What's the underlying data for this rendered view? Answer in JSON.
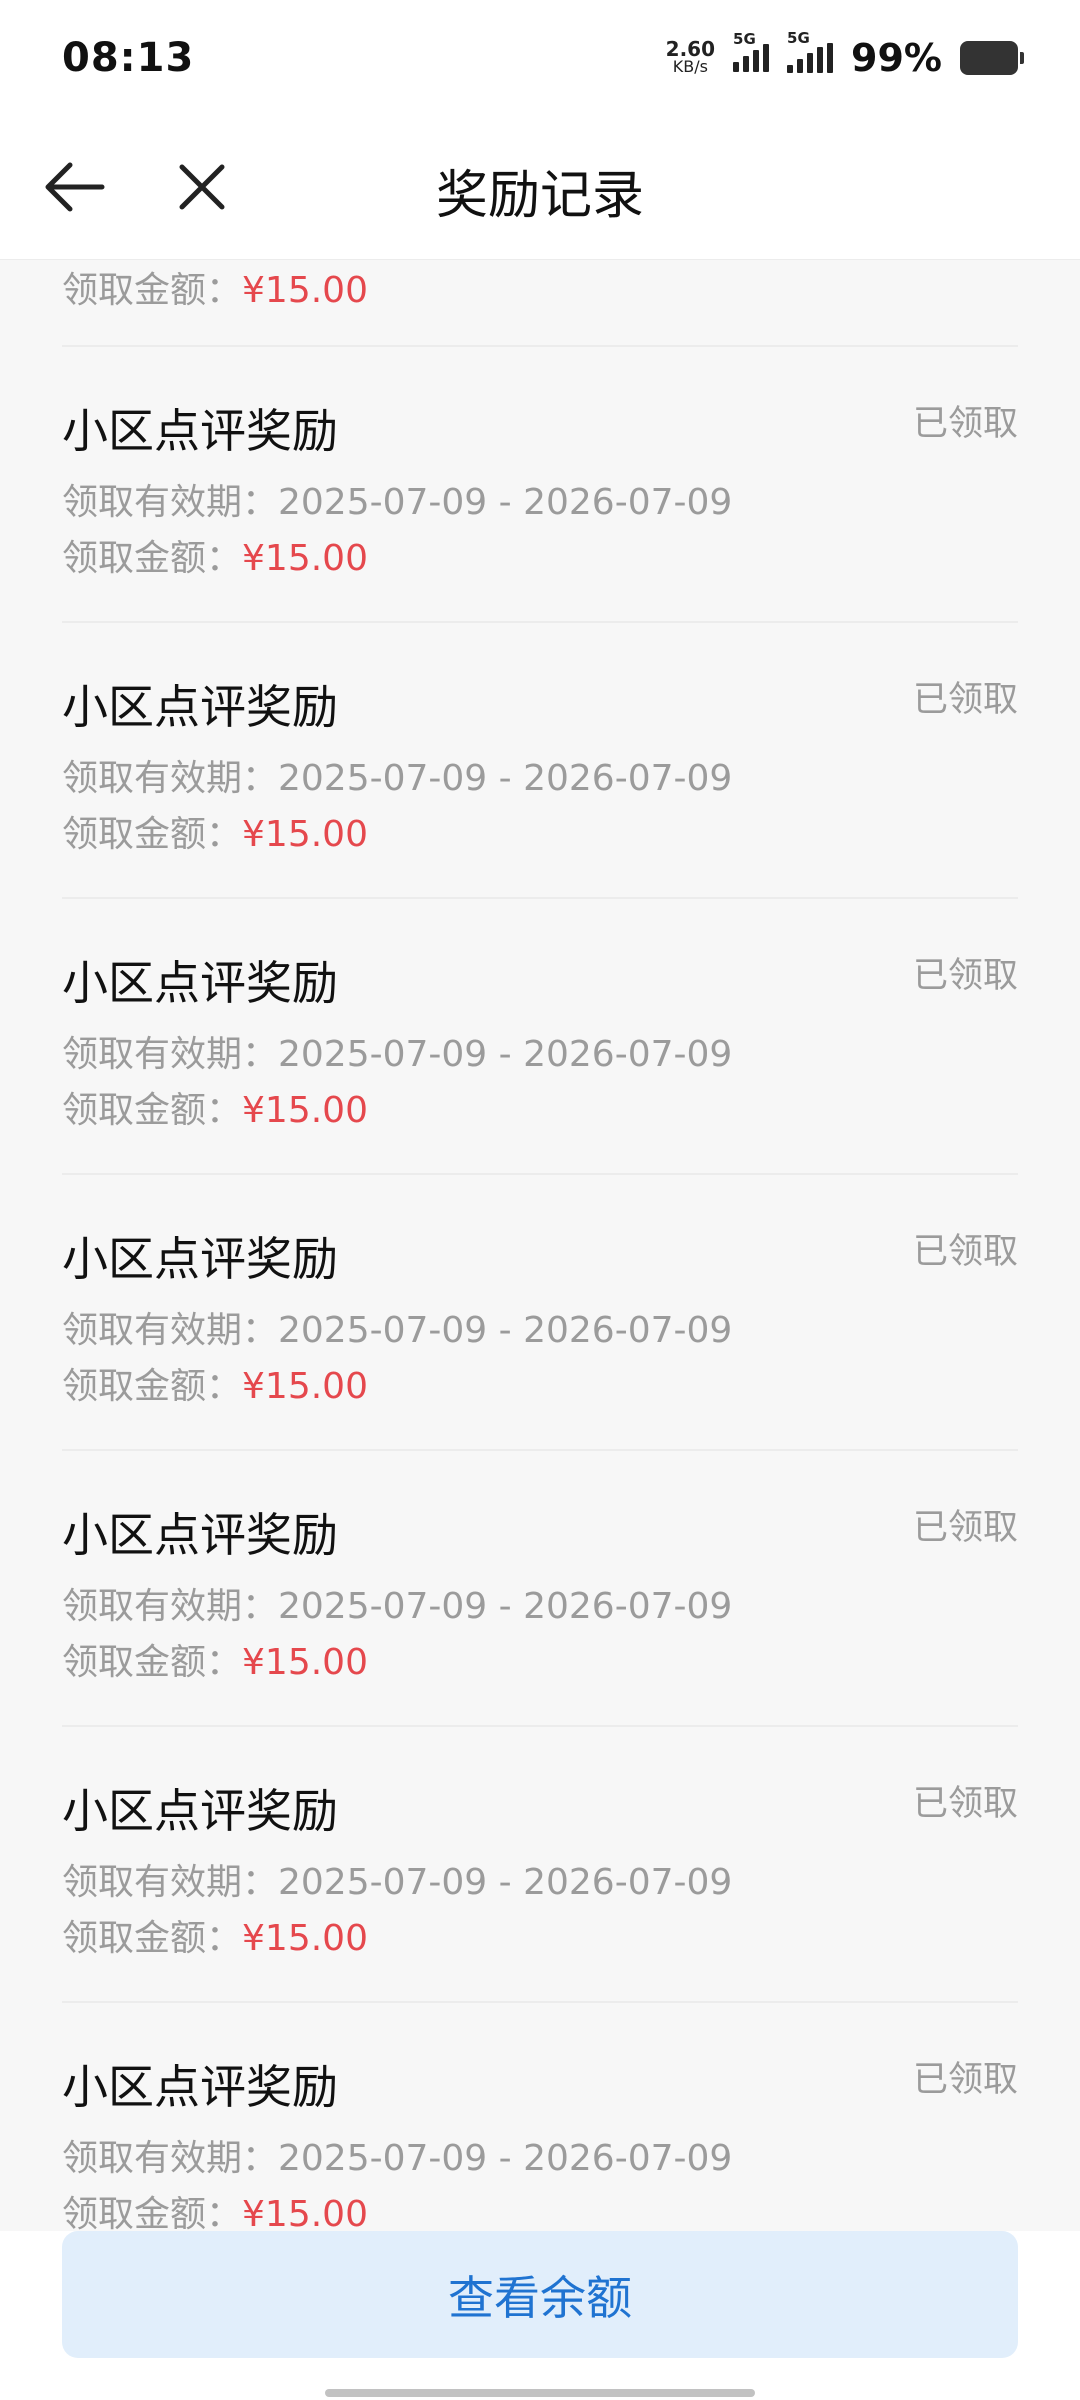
{
  "status": {
    "time": "08:13",
    "speed_value": "2.60",
    "speed_unit": "KB/s",
    "net1": "5G",
    "net2": "5G",
    "battery": "99%"
  },
  "nav": {
    "title": "奖励记录",
    "back_icon": "arrow-left-icon",
    "close_icon": "close-icon"
  },
  "partial_item": {
    "amount_label": "领取金额：",
    "amount": "¥15.00"
  },
  "items": [
    {
      "title": "小区点评奖励",
      "status": "已领取",
      "period": "领取有效期：2025-07-09 - 2026-07-09",
      "amount_label": "领取金额：",
      "amount": "¥15.00"
    },
    {
      "title": "小区点评奖励",
      "status": "已领取",
      "period": "领取有效期：2025-07-09 - 2026-07-09",
      "amount_label": "领取金额：",
      "amount": "¥15.00"
    },
    {
      "title": "小区点评奖励",
      "status": "已领取",
      "period": "领取有效期：2025-07-09 - 2026-07-09",
      "amount_label": "领取金额：",
      "amount": "¥15.00"
    },
    {
      "title": "小区点评奖励",
      "status": "已领取",
      "period": "领取有效期：2025-07-09 - 2026-07-09",
      "amount_label": "领取金额：",
      "amount": "¥15.00"
    },
    {
      "title": "小区点评奖励",
      "status": "已领取",
      "period": "领取有效期：2025-07-09 - 2026-07-09",
      "amount_label": "领取金额：",
      "amount": "¥15.00"
    },
    {
      "title": "小区点评奖励",
      "status": "已领取",
      "period": "领取有效期：2025-07-09 - 2026-07-09",
      "amount_label": "领取金额：",
      "amount": "¥15.00"
    },
    {
      "title": "小区点评奖励",
      "status": "已领取",
      "period": "领取有效期：2025-07-09 - 2026-07-09",
      "amount_label": "领取金额：",
      "amount": "¥15.00"
    }
  ],
  "bottom": {
    "button_label": "查看余额"
  },
  "colors": {
    "amount": "#e5484d",
    "button_bg": "#e1eefb",
    "button_text": "#1f73d1"
  }
}
